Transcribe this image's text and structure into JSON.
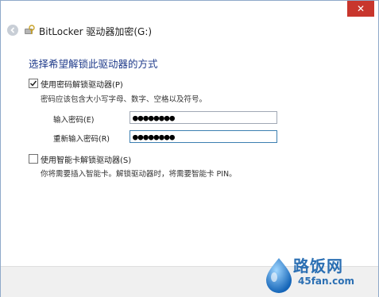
{
  "window": {
    "title": "BitLocker 驱动器加密(G:)",
    "close_glyph": "✕"
  },
  "main": {
    "heading": "选择希望解锁此驱动器的方式",
    "password_option": {
      "label": "使用密码解锁驱动器(P)",
      "checked": true,
      "hint": "密码应该包含大小写字母、数字、空格以及符号。",
      "enter_label": "输入密码(E)",
      "enter_value": "●●●●●●●●",
      "reenter_label": "重新输入密码(R)",
      "reenter_value": "●●●●●●●●"
    },
    "smartcard_option": {
      "label": "使用智能卡解锁驱动器(S)",
      "checked": false,
      "hint": "你将需要插入智能卡。解锁驱动器时，将需要智能卡 PIN。"
    }
  },
  "watermark": {
    "brand": "路饭网",
    "url": "45fan.com"
  },
  "colors": {
    "heading": "#1e3a8a",
    "close": "#c8362d",
    "brand": "#2b6fb3"
  },
  "icons": [
    "back-arrow-icon",
    "bitlocker-key-icon",
    "checkmark-icon",
    "close-icon",
    "watermark-logo-icon"
  ]
}
